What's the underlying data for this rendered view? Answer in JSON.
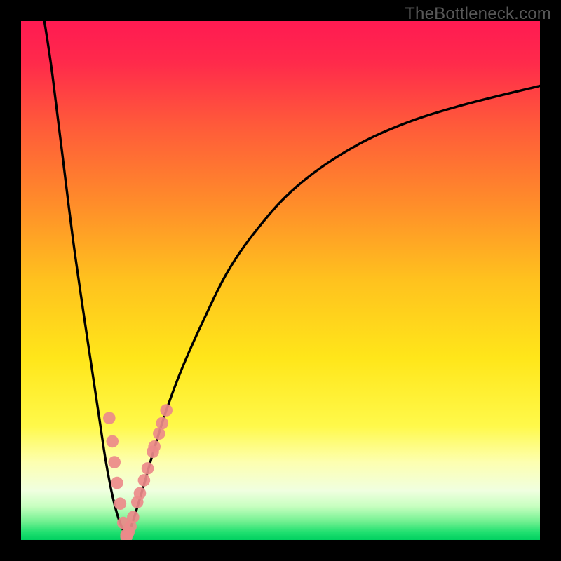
{
  "watermark": {
    "text": "TheBottleneck.com"
  },
  "colors": {
    "frame": "#000000",
    "gradient_stops": [
      {
        "offset": 0.0,
        "color": "#ff1a52"
      },
      {
        "offset": 0.08,
        "color": "#ff2a4b"
      },
      {
        "offset": 0.2,
        "color": "#ff5a3a"
      },
      {
        "offset": 0.35,
        "color": "#ff8c2a"
      },
      {
        "offset": 0.5,
        "color": "#ffc21e"
      },
      {
        "offset": 0.65,
        "color": "#ffe61a"
      },
      {
        "offset": 0.78,
        "color": "#fff94a"
      },
      {
        "offset": 0.85,
        "color": "#fdffb0"
      },
      {
        "offset": 0.905,
        "color": "#f0ffe0"
      },
      {
        "offset": 0.935,
        "color": "#c8ffc0"
      },
      {
        "offset": 0.965,
        "color": "#70f090"
      },
      {
        "offset": 0.985,
        "color": "#20e070"
      },
      {
        "offset": 1.0,
        "color": "#00d060"
      }
    ],
    "curve": "#000000",
    "marker_fill": "#ec8a8a",
    "marker_stroke": "#c54d4d"
  },
  "chart_data": {
    "type": "line",
    "title": "",
    "xlabel": "",
    "ylabel": "",
    "xlim": [
      0,
      100
    ],
    "ylim": [
      0,
      100
    ],
    "series": [
      {
        "name": "left-branch",
        "x": [
          4.5,
          6,
          8,
          10,
          12,
          13.5,
          15,
          16.2,
          17.2,
          18.1,
          18.9,
          19.7,
          20.3
        ],
        "y": [
          100,
          90,
          74,
          58,
          44,
          34,
          24,
          16,
          10.5,
          6.5,
          3.8,
          1.8,
          0.5
        ]
      },
      {
        "name": "right-branch",
        "x": [
          20.3,
          21,
          22,
          23.5,
          25.5,
          28,
          31,
          35,
          40,
          46,
          53,
          62,
          72,
          84,
          100
        ],
        "y": [
          0.5,
          2,
          5,
          10,
          17,
          25,
          33,
          42,
          52,
          60.5,
          68,
          74.5,
          79.5,
          83.5,
          87.5
        ]
      }
    ],
    "markers": {
      "name": "highlight-points",
      "points": [
        {
          "x": 17.0,
          "y": 23.5
        },
        {
          "x": 17.6,
          "y": 19.0
        },
        {
          "x": 18.0,
          "y": 15.0
        },
        {
          "x": 18.5,
          "y": 11.0
        },
        {
          "x": 19.1,
          "y": 7.0
        },
        {
          "x": 19.7,
          "y": 3.3
        },
        {
          "x": 20.3,
          "y": 1.0
        },
        {
          "x": 20.3,
          "y": 0.6
        },
        {
          "x": 20.7,
          "y": 1.5
        },
        {
          "x": 21.1,
          "y": 2.6
        },
        {
          "x": 21.6,
          "y": 4.4
        },
        {
          "x": 22.4,
          "y": 7.3
        },
        {
          "x": 22.9,
          "y": 9.0
        },
        {
          "x": 23.7,
          "y": 11.5
        },
        {
          "x": 24.4,
          "y": 13.8
        },
        {
          "x": 25.4,
          "y": 17.0
        },
        {
          "x": 25.7,
          "y": 18.0
        },
        {
          "x": 26.6,
          "y": 20.5
        },
        {
          "x": 27.2,
          "y": 22.5
        },
        {
          "x": 28.0,
          "y": 25.0
        }
      ]
    }
  }
}
